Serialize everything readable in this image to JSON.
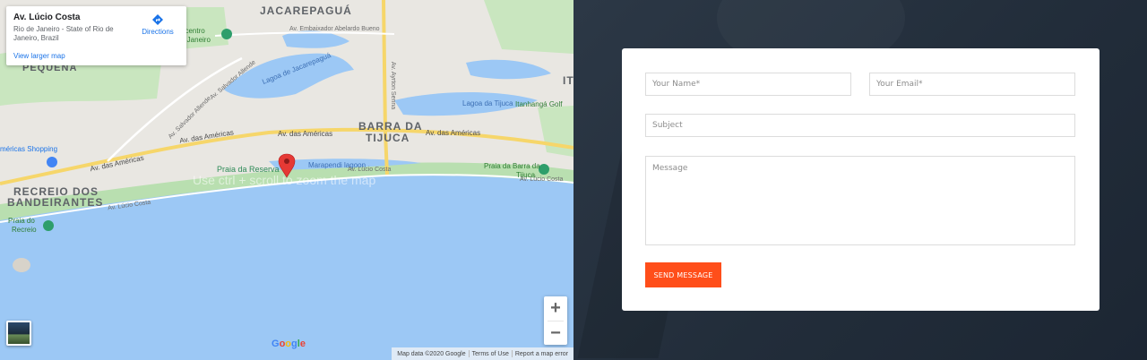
{
  "map": {
    "info_card": {
      "title": "Av. Lúcio Costa",
      "address": "Rio de Janeiro - State of Rio de Janeiro, Brazil",
      "directions_label": "Directions",
      "view_larger_label": "View larger map"
    },
    "labels": {
      "jacarepagua": "JACAREPAGUÁ",
      "pequena": "PEQUENA",
      "barra": "BARRA DA",
      "tijuca": "TIJUCA",
      "recreio": "RECREIO DOS",
      "bandeirantes": "BANDEIRANTES",
      "it": "IT",
      "lagoa_jacarepagua": "Lagoa de Jacarepaguá",
      "lagoa_tijuca": "Lagoa da Tijuca",
      "marapendi": "Marapendi lagoon",
      "praia_reserva": "Praia da Reserva",
      "praia_barra_1": "Praia da Barra da",
      "praia_barra_2": "Tijuca",
      "praia_recreio_1": "Praia do",
      "praia_recreio_2": "Recreio",
      "americas_shopping": "méricas Shopping",
      "itanhanga": "Itanhangá Golf",
      "centro_1": "ocentro",
      "centro_2": "e Janeiro",
      "av_americas_1": "Av. das Américas",
      "av_americas_2": "Av. das Américas",
      "av_americas_3": "Av. das Américas",
      "av_americas_4": "Av. das Américas",
      "av_salvador_1": "Av. Salvador Allende",
      "av_salvador_2": "Av. Salvador Allende",
      "av_embaixador": "Av. Embaixador Abelardo Bueno",
      "av_lucio_1": "Av. Lúcio Costa",
      "av_lucio_2": "Av. Lúcio Costa",
      "av_lucio_3": "Av. Lúcio Costa",
      "av_ayrton": "Av. Ayrton Senna",
      "hint": "Use ctrl + scroll to zoom the map"
    },
    "zoom_in": "+",
    "zoom_out": "−",
    "google_logo": "Google",
    "attribution": [
      "Map data ©2020 Google",
      "Terms of Use",
      "Report a map error"
    ],
    "colors": {
      "water": "#9cc8f5",
      "park": "#b9dfb0",
      "land": "#e9e7e2",
      "highway": "#f6d66a",
      "pin": "#e53935"
    }
  },
  "form": {
    "name_placeholder": "Your Name*",
    "email_placeholder": "Your Email*",
    "subject_placeholder": "Subject",
    "message_placeholder": "Message",
    "send_label": "SEND MESSAGE",
    "accent_color": "#ff4e1a"
  }
}
